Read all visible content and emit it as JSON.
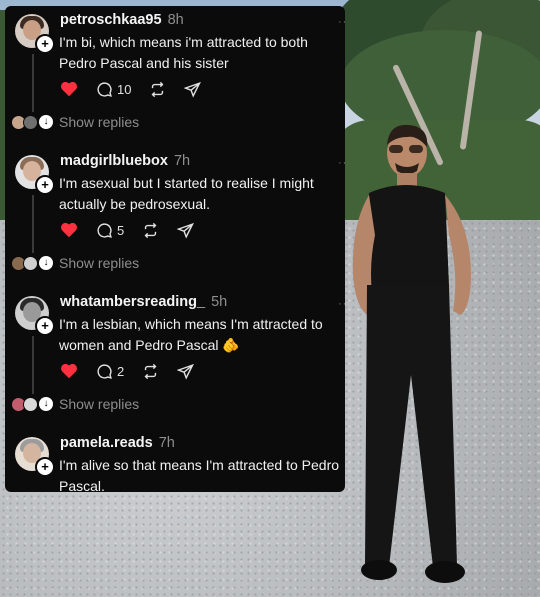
{
  "comments": [
    {
      "username": "petroschkaa95",
      "time": "8h",
      "text": "I'm bi, which means i'm attracted to both Pedro Pascal and his sister",
      "like_count": "",
      "reply_count": "10",
      "show_replies_label": "Show replies"
    },
    {
      "username": "madgirlbluebox",
      "time": "7h",
      "text": "I'm asexual but I started to realise I might actually be pedrosexual.",
      "like_count": "",
      "reply_count": "5",
      "show_replies_label": "Show replies"
    },
    {
      "username": "whatambersreading_",
      "time": "5h",
      "text": "I'm a lesbian, which means I'm attracted to women and Pedro Pascal 🫵",
      "like_count": "",
      "reply_count": "2",
      "show_replies_label": "Show replies"
    },
    {
      "username": "pamela.reads",
      "time": "7h",
      "text": "I'm alive so that means I'm attracted to Pedro Pascal.",
      "like_count": "",
      "reply_count": "",
      "show_replies_label": ""
    }
  ],
  "colors": {
    "panel_bg": "#0b0b0b",
    "heart_red": "#ff3040",
    "muted_text": "#8e8e8e"
  }
}
